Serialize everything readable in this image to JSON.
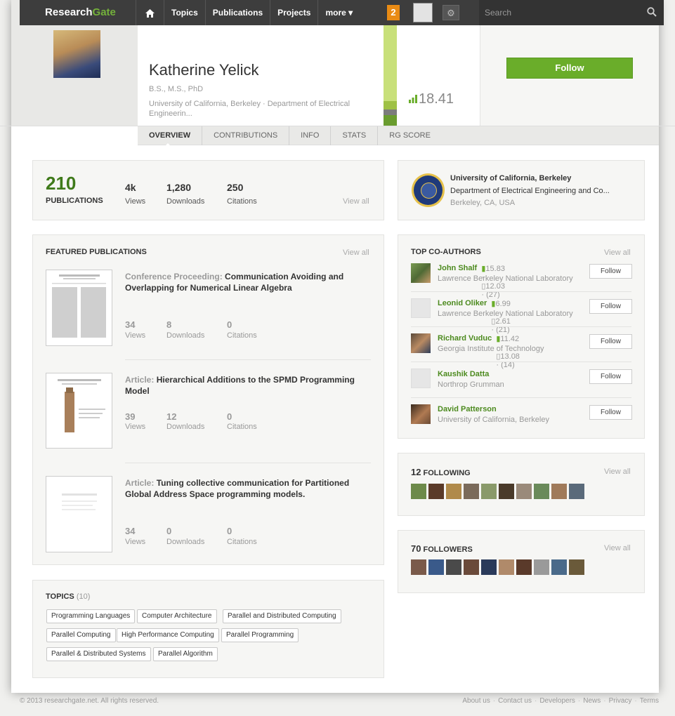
{
  "topbar": {
    "logo_main": "Research",
    "logo_accent": "Gate",
    "nav": [
      "Topics",
      "Publications",
      "Projects",
      "more ▾"
    ],
    "notifications": "2",
    "search_placeholder": "Search"
  },
  "profile": {
    "name": "Katherine Yelick",
    "degrees": "B.S., M.S., PhD",
    "affiliation": "University of California, Berkeley · Department of Electrical Engineerin...",
    "rg_score": "18.41",
    "follow_label": "Follow"
  },
  "tabs": [
    "OVERVIEW",
    "CONTRIBUTIONS",
    "INFO",
    "STATS",
    "RG SCORE"
  ],
  "stats": {
    "publications_value": "210",
    "publications_label": "PUBLICATIONS",
    "views_value": "4k",
    "views_label": "Views",
    "downloads_value": "1,280",
    "downloads_label": "Downloads",
    "citations_value": "250",
    "citations_label": "Citations",
    "view_all": "View all"
  },
  "institution": {
    "name": "University of California, Berkeley",
    "department": "Department of Electrical Engineering and Co...",
    "location": "Berkeley, CA, USA"
  },
  "featured": {
    "title": "FEATURED PUBLICATIONS",
    "view_all": "View all",
    "items": [
      {
        "type": "Conference Proceeding:",
        "title": "Communication Avoiding and Overlapping for Numerical Linear Algebra",
        "views": "34",
        "downloads": "8",
        "citations": "0"
      },
      {
        "type": "Article:",
        "title": "Hierarchical Additions to the SPMD Programming Model",
        "views": "39",
        "downloads": "12",
        "citations": "0"
      },
      {
        "type": "Article:",
        "title": "Tuning collective communication for Partitioned Global Address Space programming models.",
        "views": "34",
        "downloads": "0",
        "citations": "0"
      }
    ],
    "labels": {
      "views": "Views",
      "downloads": "Downloads",
      "citations": "Citations"
    }
  },
  "coauthors": {
    "title": "TOP CO-AUTHORS",
    "view_all": "View all",
    "follow_label": "Follow",
    "items": [
      {
        "name": "John Shalf",
        "metrics": "15.83 · ▯12.03 · (27)",
        "inst": "Lawrence Berkeley National Laboratory"
      },
      {
        "name": "Leonid Oliker",
        "metrics": "6.99 · ▯2.61 · (21)",
        "inst": "Lawrence Berkeley National Laboratory"
      },
      {
        "name": "Richard Vuduc",
        "metrics": "11.42 · ▯13.08 · (14)",
        "inst": "Georgia Institute of Technology"
      },
      {
        "name": "Kaushik Datta",
        "metrics": "",
        "inst": "Northrop Grumman"
      },
      {
        "name": "David Patterson",
        "metrics": "",
        "inst": "University of California, Berkeley"
      }
    ]
  },
  "following": {
    "count": "12",
    "label": "FOLLOWING",
    "view_all": "View all"
  },
  "followers": {
    "count": "70",
    "label": "FOLLOWERS",
    "view_all": "View all"
  },
  "topics": {
    "title": "TOPICS",
    "count": "(10)",
    "items": [
      "Programming Languages",
      "Computer Architecture",
      "Parallel and Distributed Computing",
      "Parallel Computing",
      "High Performance Computing",
      "Parallel Programming",
      "Parallel & Distributed Systems",
      "Parallel Algorithm"
    ]
  },
  "footer": {
    "copyright": "© 2013 researchgate.net. All rights reserved.",
    "links": [
      "About us",
      "Contact us",
      "Developers",
      "News",
      "Privacy",
      "Terms"
    ]
  }
}
